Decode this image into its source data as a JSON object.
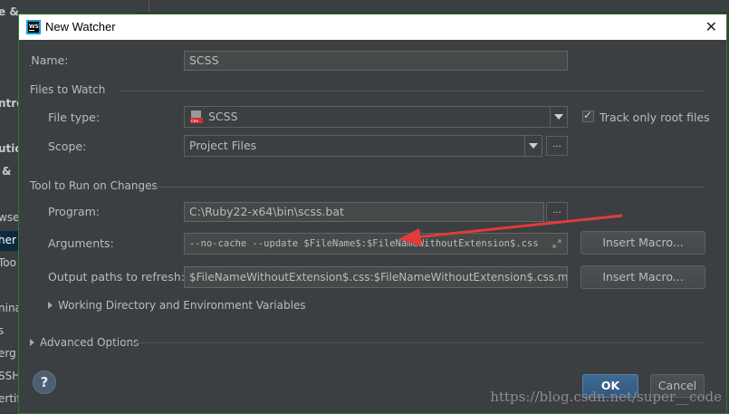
{
  "background": {
    "fragments": [
      "e & Behavior",
      "ntro",
      "utio",
      "&",
      "wse",
      "her",
      "Too",
      "nina",
      "s",
      "erg",
      "SSH",
      "ertif"
    ]
  },
  "dialog": {
    "title": "New Watcher",
    "name_label": "Name:",
    "name_value": "SCSS",
    "files_section": "Files to Watch",
    "file_type_label": "File type:",
    "file_type_value": "SCSS",
    "track_root_label": "Track only root files",
    "track_root_checked": true,
    "scope_label": "Scope:",
    "scope_value": "Project Files",
    "tool_section": "Tool to Run on Changes",
    "program_label": "Program:",
    "program_value": "C:\\Ruby22-x64\\bin\\scss.bat",
    "arguments_label": "Arguments:",
    "arguments_value": "--no-cache --update $FileName$:$FileNameWithoutExtension$.css",
    "output_label": "Output paths to refresh:",
    "output_value": "$FileNameWithoutExtension$.css:$FileNameWithoutExtension$.css.map",
    "insert_macro_1": "Insert Macro...",
    "insert_macro_2": "Insert Macro...",
    "working_dir_label": "Working Directory and Environment Variables",
    "advanced_label": "Advanced Options",
    "ok_label": "OK",
    "cancel_label": "Cancel",
    "help_label": "?",
    "dots_label": "..."
  },
  "watermark": "https://blog.csdn.net/super__code",
  "colors": {
    "accent": "#365880",
    "annotation_arrow": "#e03c3c",
    "dialog_border": "#2f7a2f"
  }
}
